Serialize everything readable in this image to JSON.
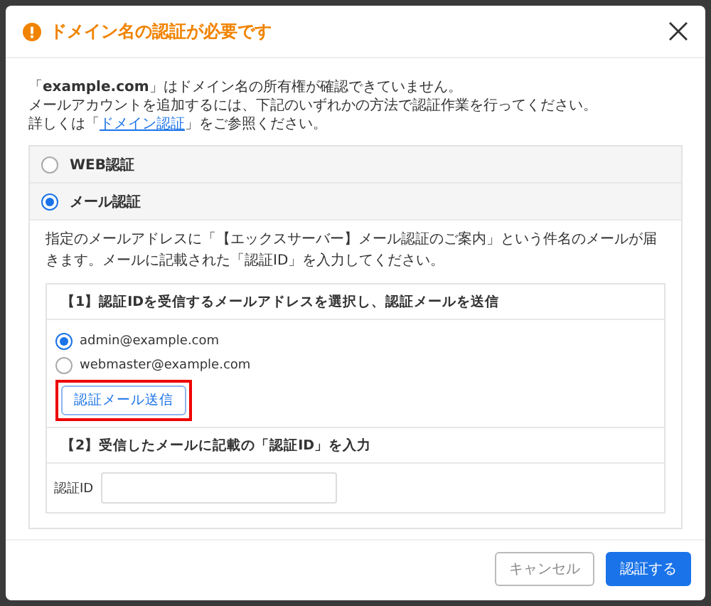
{
  "dialog": {
    "title": "ドメイン名の認証が必要です",
    "intro_lines": [
      "「**example.com**」はドメイン名の所有権が確認できていません。",
      "メールアカウントを追加するには、下記のいずれかの方法で認証作業を行ってください。"
    ],
    "help": {
      "before": "詳しくは「",
      "link": "ドメイン認証",
      "after": "」をご参照ください。"
    },
    "methods": [
      {
        "label": "WEB認証",
        "selected": false
      },
      {
        "label": "メール認証",
        "selected": true,
        "description": "指定のメールアドレスに「【エックスサーバー】メール認証のご案内」という件名のメールが届きます。メールに記載された「認証ID」を入力してください。",
        "step1": {
          "title": "【1】認証IDを受信するメールアドレスを選択し、認証メールを送信",
          "addresses": [
            {
              "label": "admin@example.com",
              "selected": true
            },
            {
              "label": "webmaster@example.com",
              "selected": false
            }
          ],
          "send_button": {
            "label": "認証メール送信",
            "highlighted": true
          }
        },
        "step2": {
          "title": "【2】受信したメールに記載の「認証ID」を入力",
          "field_label": "認証ID"
        }
      }
    ],
    "buttons": [
      {
        "label": "キャンセル",
        "kind": "secondary"
      },
      {
        "label": "認証する",
        "kind": "primary"
      }
    ]
  }
}
